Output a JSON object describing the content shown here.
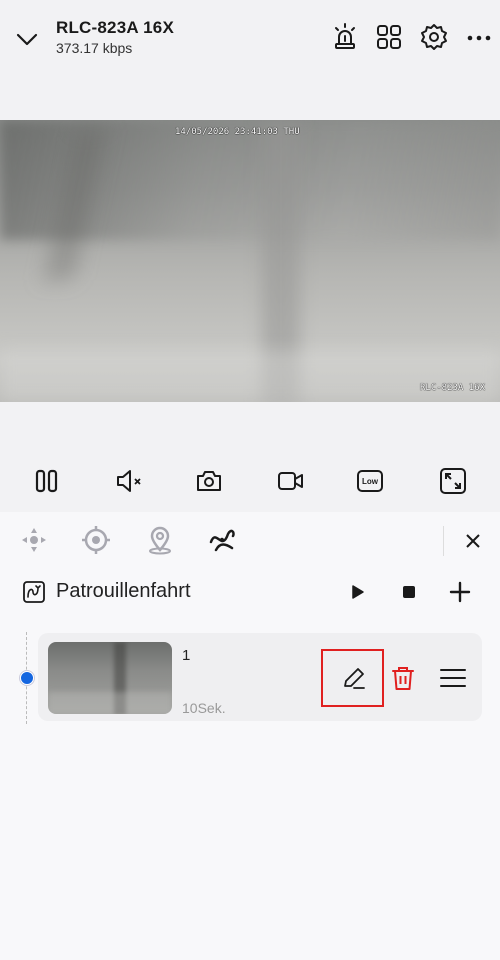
{
  "header": {
    "title": "RLC-823A 16X",
    "bitrate": "373.17 kbps",
    "icons": [
      "chevron-down-icon",
      "siren-icon",
      "grid-icon",
      "gear-icon",
      "more-icon"
    ]
  },
  "video": {
    "timestamp": "14/05/2026 23:41:03 THU",
    "camera_label": "RLC-823A 16X"
  },
  "controls": {
    "icons": [
      "pause-icon",
      "mute-icon",
      "snapshot-icon",
      "record-icon",
      "quality-icon",
      "fullscreen-icon"
    ],
    "quality_label": "Low"
  },
  "ptz_tabs": {
    "icons": [
      "ptz-direction-icon",
      "focus-icon",
      "preset-location-icon",
      "patrol-icon"
    ],
    "active": "patrol-icon"
  },
  "patrol": {
    "title": "Patrouillenfahrt",
    "items": [
      {
        "name": "1",
        "duration": "10Sek."
      }
    ]
  },
  "colors": {
    "accent_blue": "#1466e0",
    "delete_red": "#e02020",
    "highlight_red": "#e02020"
  }
}
